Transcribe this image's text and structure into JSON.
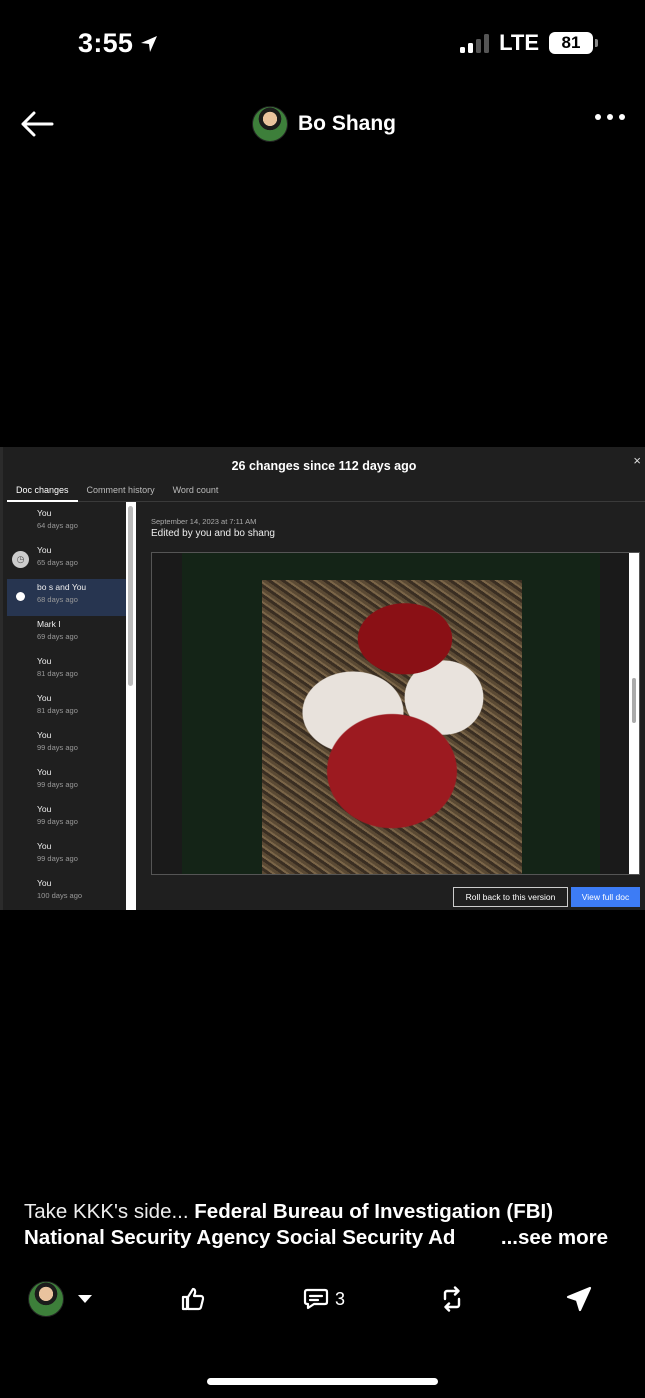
{
  "status_bar": {
    "time": "3:55",
    "network": "LTE",
    "battery": "81"
  },
  "header": {
    "name": "Bo Shang"
  },
  "panel": {
    "title": "26 changes since 112 days ago",
    "close": "×",
    "tabs": [
      "Doc changes",
      "Comment history",
      "Word count"
    ],
    "history": [
      {
        "name": "You",
        "date": "64 days ago"
      },
      {
        "name": "You",
        "date": "65 days ago"
      },
      {
        "name": "bo s and You",
        "date": "68 days ago"
      },
      {
        "name": "Mark I",
        "date": "69 days ago"
      },
      {
        "name": "You",
        "date": "81 days ago"
      },
      {
        "name": "You",
        "date": "81 days ago"
      },
      {
        "name": "You",
        "date": "99 days ago"
      },
      {
        "name": "You",
        "date": "99 days ago"
      },
      {
        "name": "You",
        "date": "99 days ago"
      },
      {
        "name": "You",
        "date": "99 days ago"
      },
      {
        "name": "You",
        "date": "100 days ago"
      }
    ],
    "detail_date": "September 14, 2023 at 7:11 AM",
    "detail_edit": "Edited by you and bo shang",
    "rollback_label": "Roll back to this version",
    "viewfull_label": "View full doc"
  },
  "caption": {
    "plain": "Take KKK's side... ",
    "bold1": "Federal Bureau of Investigation (FBI)",
    "bold2": "National Security Agency Social Security Ad",
    "see_more": "...see more"
  },
  "actions": {
    "comment_count": "3"
  }
}
